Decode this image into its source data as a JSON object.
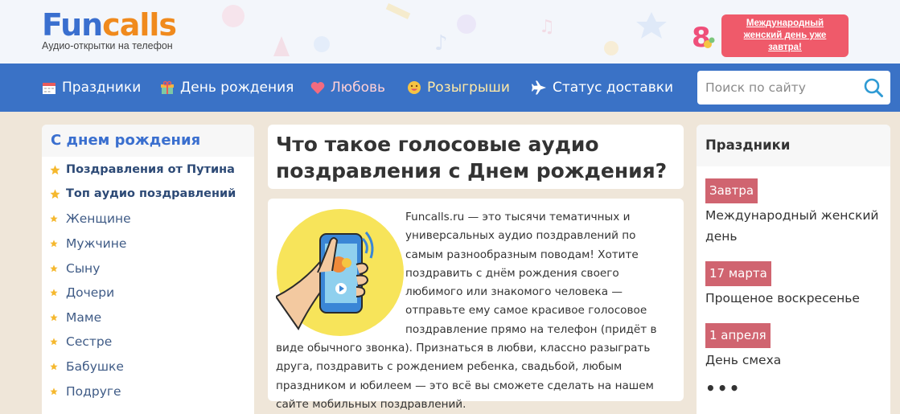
{
  "header": {
    "logo": {
      "part1": "Fun",
      "part2": "calls",
      "tagline": "Аудио-открытки на телефон"
    },
    "promo": {
      "badge_number": "8",
      "text": "Международный женский день уже завтра!"
    }
  },
  "nav": {
    "items": [
      {
        "label": "Праздники",
        "icon": "calendar-icon"
      },
      {
        "label": "День рождения",
        "icon": "gift-icon"
      },
      {
        "label": "Любовь",
        "icon": "heart-icon"
      },
      {
        "label": "Розыгрыши",
        "icon": "smiley-icon"
      },
      {
        "label": "Статус доставки",
        "icon": "plane-icon"
      }
    ],
    "search_placeholder": "Поиск по сайту"
  },
  "sidebar": {
    "title": "С днем рождения",
    "items": [
      {
        "label": "Поздравления от Путина",
        "featured": true
      },
      {
        "label": "Топ аудио поздравлений",
        "featured": true
      },
      {
        "label": "Женщине",
        "featured": false
      },
      {
        "label": "Мужчине",
        "featured": false
      },
      {
        "label": "Сыну",
        "featured": false
      },
      {
        "label": "Дочери",
        "featured": false
      },
      {
        "label": "Маме",
        "featured": false
      },
      {
        "label": "Сестре",
        "featured": false
      },
      {
        "label": "Бабушке",
        "featured": false
      },
      {
        "label": "Подруге",
        "featured": false
      }
    ]
  },
  "main": {
    "title": "Что такое голосовые аудио поздравления с Днем рождения?",
    "text": "Funcalls.ru — это тысячи тематичных и универсальных аудио поздравлений по самым разнообразным поводам! Хотите поздравить с днём рождения своего любимого или знакомого человека — отправьте ему самое красивое голосовое поздравление прямо на телефон (придёт в виде обычного звонка). Признаться в любви, классно разыграть друга, поздравить с рождением ребенка, свадьбой, любым праздником и юбилеем — это всё вы сможете сделать на нашем сайте мобильных поздравлений."
  },
  "holidays": {
    "title": "Праздники",
    "items": [
      {
        "date": "Завтра",
        "name": "Международный женский день"
      },
      {
        "date": "17 марта",
        "name": "Прощеное воскресенье"
      },
      {
        "date": "1 апреля",
        "name": "День смеха"
      }
    ],
    "more": "•••"
  },
  "colors": {
    "brand_blue": "#3a72c6",
    "brand_orange": "#f08a1d",
    "promo_red": "#ef5a6a",
    "date_badge": "#d06470",
    "page_bg": "#efe6d9"
  }
}
